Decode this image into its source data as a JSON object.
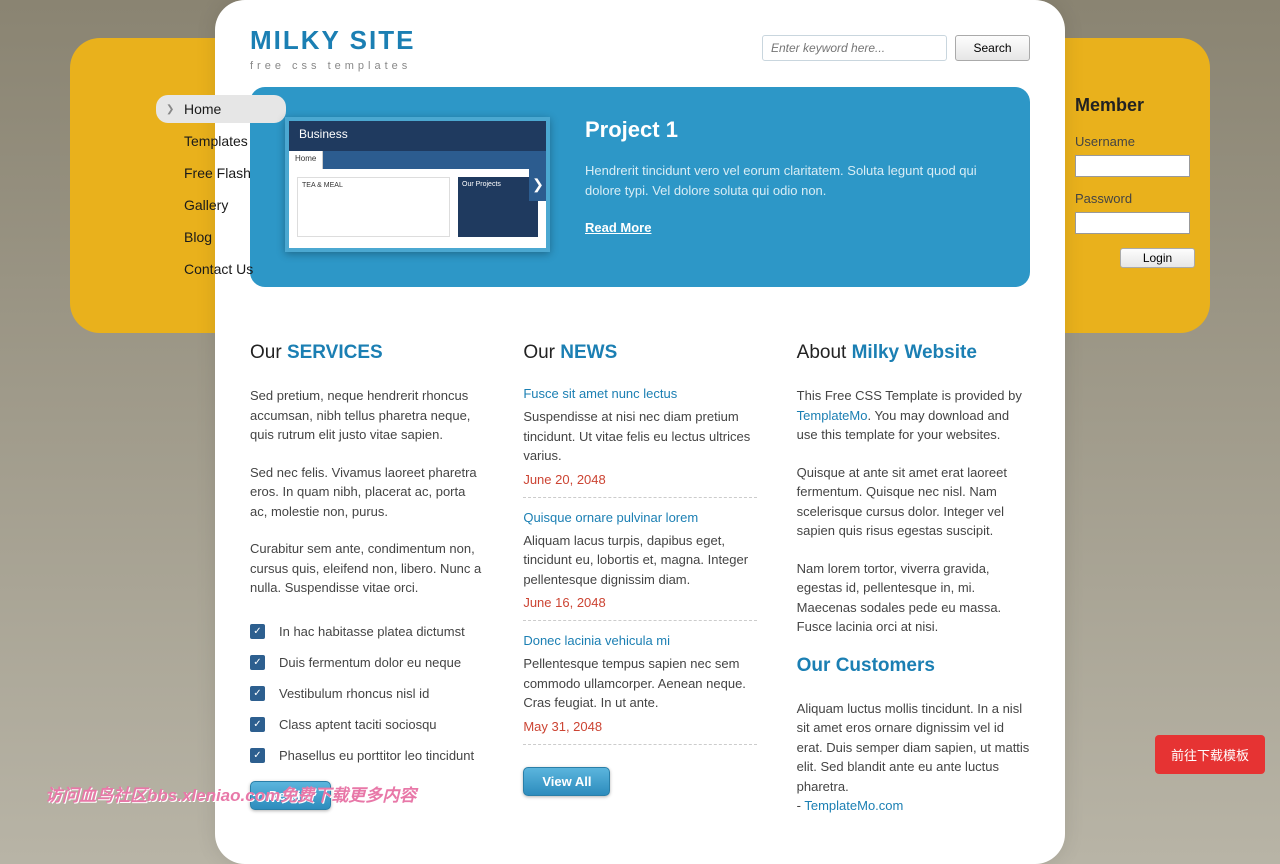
{
  "site": {
    "title": "MILKY SITE",
    "tagline": "free css templates"
  },
  "search": {
    "placeholder": "Enter keyword here...",
    "button": "Search"
  },
  "nav": [
    {
      "label": "Home",
      "active": true
    },
    {
      "label": "Templates",
      "active": false
    },
    {
      "label": "Free Flash",
      "active": false
    },
    {
      "label": "Gallery",
      "active": false
    },
    {
      "label": "Blog",
      "active": false
    },
    {
      "label": "Contact Us",
      "active": false
    }
  ],
  "hero": {
    "title": "Project 1",
    "text": "Hendrerit tincidunt vero vel eorum claritatem. Soluta legunt quod qui dolore typi. Vel dolore soluta qui odio non.",
    "link": "Read More",
    "thumb_title": "Business"
  },
  "member": {
    "heading": "Member",
    "user_label": "Username",
    "pass_label": "Password",
    "login": "Login"
  },
  "services": {
    "heading_pre": "Our ",
    "heading_strong": "SERVICES",
    "p1": "Sed pretium, neque hendrerit rhoncus accumsan, nibh tellus pharetra neque, quis rutrum elit justo vitae sapien.",
    "p2": "Sed nec felis. Vivamus laoreet pharetra eros. In quam nibh, placerat ac, porta ac, molestie non, purus.",
    "p3": "Curabitur sem ante, condimentum non, cursus quis, eleifend non, libero. Nunc a nulla. Suspendisse vitae orci.",
    "checks": [
      "In hac habitasse platea dictumst",
      "Duis fermentum dolor eu neque",
      "Vestibulum rhoncus nisl id",
      "Class aptent taciti sociosqu",
      "Phasellus eu porttitor leo tincidunt"
    ],
    "button": "Details"
  },
  "news": {
    "heading_pre": "Our ",
    "heading_strong": "NEWS",
    "items": [
      {
        "title": "Fusce sit amet nunc lectus",
        "text": "Suspendisse at nisi nec diam pretium tincidunt. Ut vitae felis eu lectus ultrices varius.",
        "date": "June 20, 2048"
      },
      {
        "title": "Quisque ornare pulvinar lorem",
        "text": "Aliquam lacus turpis, dapibus eget, tincidunt eu, lobortis et, magna. Integer pellentesque dignissim diam.",
        "date": "June 16, 2048"
      },
      {
        "title": "Donec lacinia vehicula mi",
        "text": "Pellentesque tempus sapien nec sem commodo ullamcorper. Aenean neque. Cras feugiat. In ut ante.",
        "date": "May 31, 2048"
      }
    ],
    "button": "View All"
  },
  "about": {
    "heading_pre": "About ",
    "heading_strong": "Milky Website",
    "p1a": "This Free CSS Template is provided by ",
    "p1link": "TemplateMo",
    "p1b": ". You may download and use this template for your websites.",
    "p2": "Quisque at ante sit amet erat laoreet fermentum. Quisque nec nisl. Nam scelerisque cursus dolor. Integer vel sapien quis risus egestas suscipit.",
    "p3": "Nam lorem tortor, viverra gravida, egestas id, pellentesque in, mi. Maecenas sodales pede eu massa. Fusce lacinia orci at nisi.",
    "customers_heading": "Our Customers",
    "customers_text": "Aliquam luctus mollis tincidunt. In a nisl sit amet eros ornare dignissim vel id erat. Duis semper diam sapien, ut mattis elit. Sed blandit ante eu ante luctus pharetra.",
    "customers_link": "TemplateMo.com"
  },
  "floating_button": "前往下载模板",
  "watermark": "访问血鸟社区bbs.xleniao.com免费下载更多内容"
}
